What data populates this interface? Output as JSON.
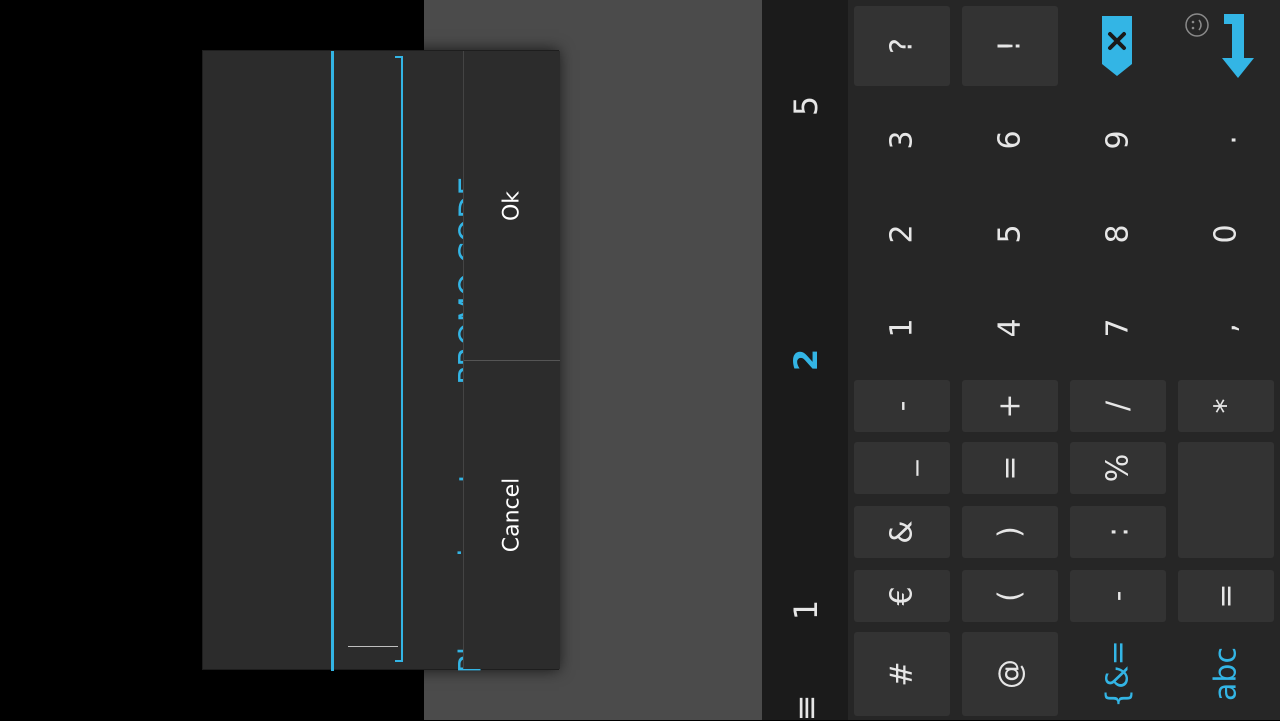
{
  "dialog": {
    "title": "Please, insert your PROMO CODE",
    "input_value": "",
    "ok_label": "Ok",
    "cancel_label": "Cancel"
  },
  "suggestions": [
    "5",
    "2",
    "1",
    "≡"
  ],
  "keyboard": {
    "rows": [
      [
        "?",
        "!",
        "",
        ""
      ],
      [
        "3",
        "6",
        "9",
        "."
      ],
      [
        "2",
        "5",
        "8",
        "0"
      ],
      [
        "1",
        "4",
        "7",
        ","
      ],
      [
        "-",
        "+",
        "/",
        "*"
      ],
      [
        "_",
        "=",
        "%",
        ""
      ],
      [
        "&",
        ")",
        ":",
        ""
      ],
      [
        "€",
        "(",
        "-",
        "="
      ],
      [
        "#",
        "@",
        "{&=",
        "abc"
      ]
    ],
    "icons": {
      "close": "close-icon",
      "collapse": "collapse-arrow-icon",
      "emoji": "emoji-icon"
    }
  },
  "colors": {
    "accent": "#33b5e5",
    "dialog_bg": "#2c2c2c",
    "keyboard_bg": "#262626",
    "key_bg": "#333333"
  }
}
